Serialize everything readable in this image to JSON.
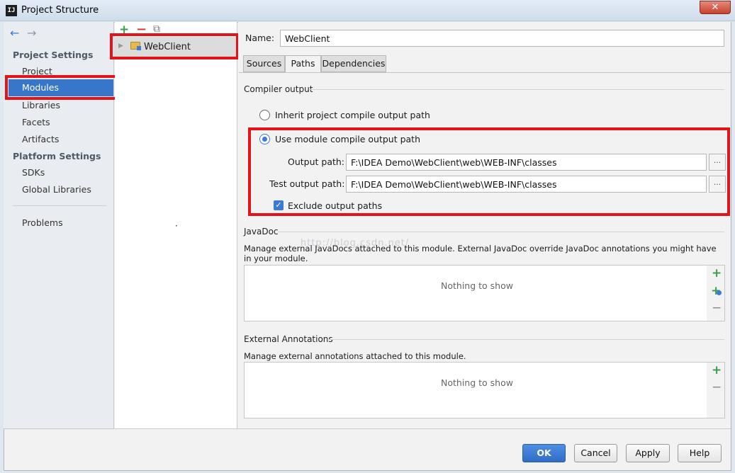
{
  "window": {
    "title": "Project Structure",
    "app_icon": "IJ",
    "close_glyph": "✕"
  },
  "nav": {
    "back_icon": "←",
    "forward_icon": "→",
    "project_settings": "Project Settings",
    "items_project": [
      "Project",
      "Modules",
      "Libraries",
      "Facets",
      "Artifacts"
    ],
    "platform_settings": "Platform Settings",
    "items_platform": [
      "SDKs",
      "Global Libraries"
    ],
    "problems": "Problems",
    "selected": "Modules"
  },
  "modules_panel": {
    "add_icon": "+",
    "remove_icon": "−",
    "copy_icon": "⧉",
    "tree_arrow": "▶",
    "module_name": "WebClient",
    "dot": "·"
  },
  "details": {
    "name_label": "Name:",
    "name_value": "WebClient",
    "tabs": [
      "Sources",
      "Paths",
      "Dependencies"
    ],
    "active_tab": "Paths",
    "compiler_output": {
      "heading": "Compiler output",
      "inherit_label": "Inherit project compile output path",
      "use_module_label": "Use module compile output path",
      "output_path_label": "Output path:",
      "output_path_value": "F:\\IDEA Demo\\WebClient\\web\\WEB-INF\\classes",
      "test_output_path_label": "Test output path:",
      "test_output_path_value": "F:\\IDEA Demo\\WebClient\\web\\WEB-INF\\classes",
      "browse_label": "...",
      "exclude_label": "Exclude output paths",
      "exclude_checked": true,
      "selected": "use_module"
    },
    "javadoc": {
      "heading": "JavaDoc",
      "description": "Manage external JavaDocs attached to this module. External JavaDoc override JavaDoc annotations you might have in your module.",
      "empty_text": "Nothing to show",
      "add_icon": "+",
      "add_url_icon": "+",
      "remove_icon": "−"
    },
    "watermark": "http://blog.csdn.net/",
    "external_annotations": {
      "heading": "External Annotations",
      "description": "Manage external annotations attached to this module.",
      "empty_text": "Nothing to show",
      "add_icon": "+",
      "remove_icon": "−"
    }
  },
  "buttons": {
    "ok": "OK",
    "cancel": "Cancel",
    "apply": "Apply",
    "help": "Help"
  },
  "colors": {
    "highlight_red": "#e2141a",
    "selection_blue": "#3876c9",
    "accent": "#3a7bd5"
  }
}
